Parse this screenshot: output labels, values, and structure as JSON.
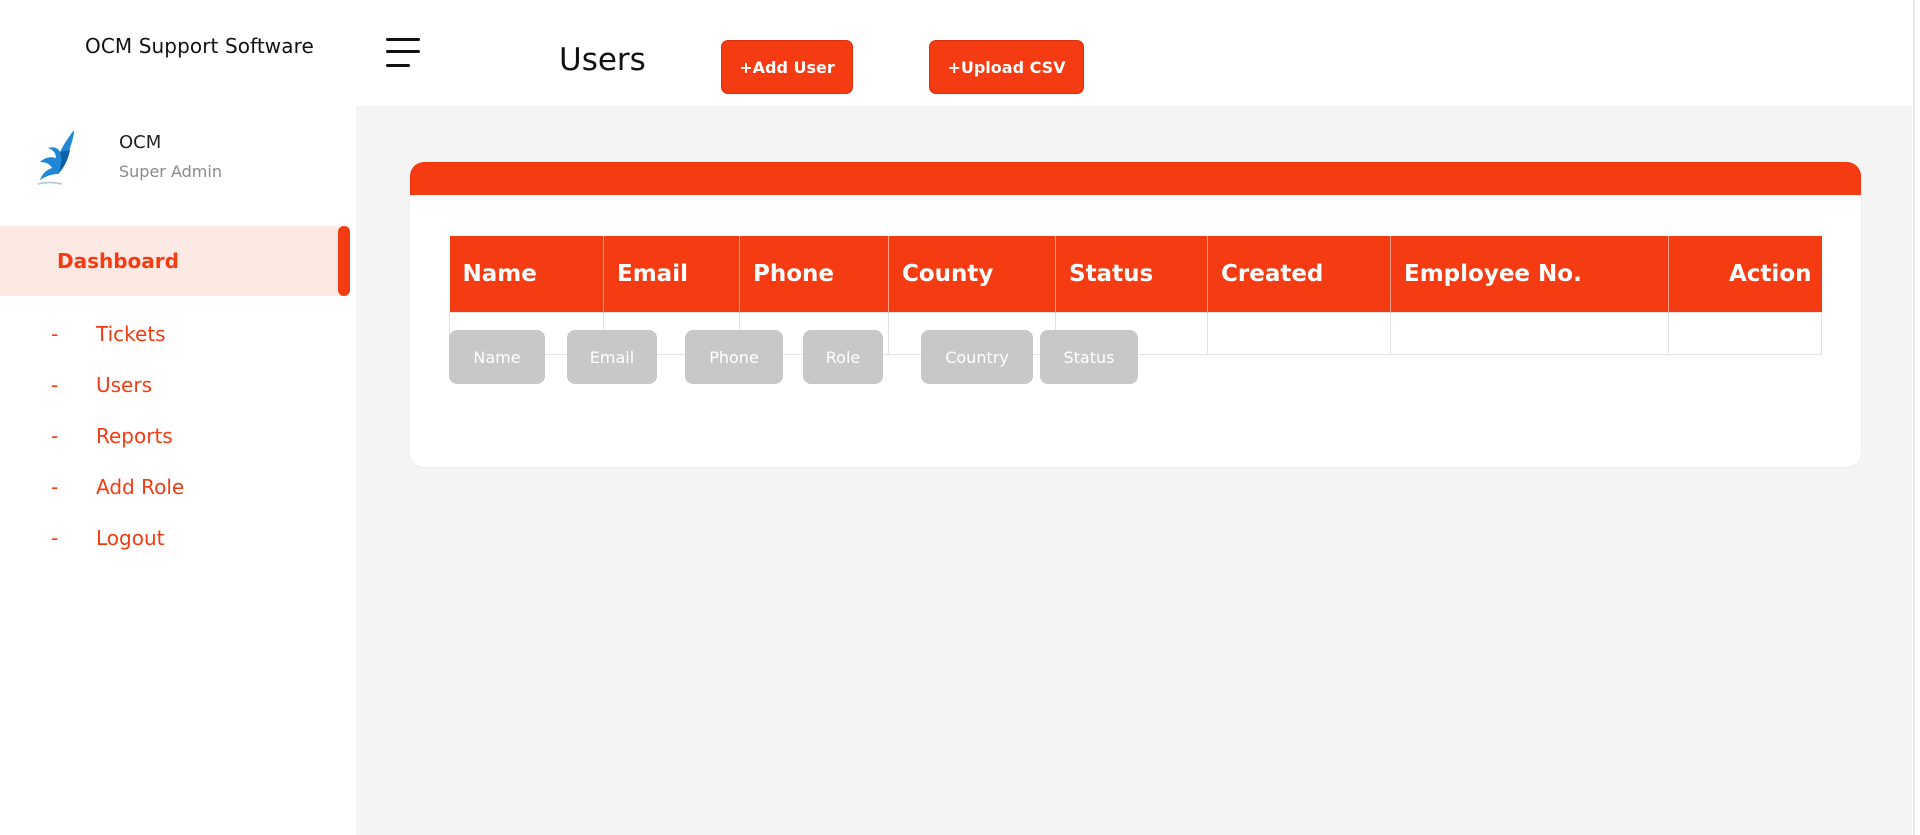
{
  "app": {
    "brand": "OCM Support Software"
  },
  "profile": {
    "name": "OCM",
    "role": "Super Admin",
    "avatar_icon": "bird-logo-icon"
  },
  "sidebar": {
    "active": {
      "label": "Dashboard"
    },
    "items": [
      {
        "dash": "-",
        "label": "Tickets"
      },
      {
        "dash": "-",
        "label": "Users"
      },
      {
        "dash": "-",
        "label": "Reports"
      },
      {
        "dash": "-",
        "label": "Add Role"
      },
      {
        "dash": "-",
        "label": "Logout"
      }
    ]
  },
  "header": {
    "title": "Users",
    "add_user_label": "+Add User",
    "upload_csv_label": "+Upload CSV"
  },
  "table": {
    "columns": [
      "Name",
      "Email",
      "Phone",
      "County",
      "Status",
      "Created",
      "Employee No.",
      "Action"
    ],
    "rows": []
  },
  "filters": [
    "Name",
    "Email",
    "Phone",
    "Role",
    "Country",
    "Status"
  ],
  "colors": {
    "accent": "#f53b12",
    "accent_light": "#fde9e3",
    "filter_bg": "#c8c8c8",
    "main_bg": "#f4f4f4"
  }
}
